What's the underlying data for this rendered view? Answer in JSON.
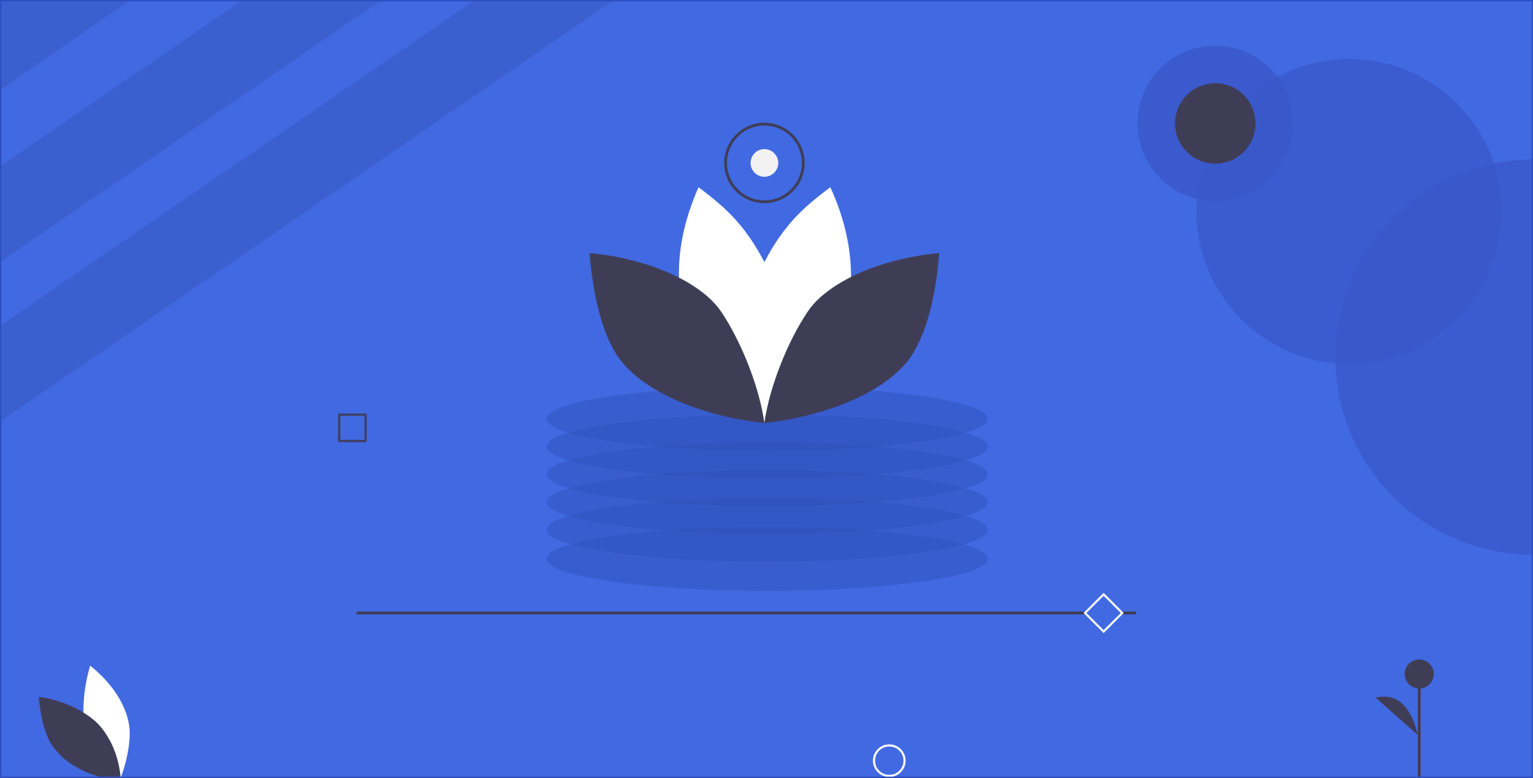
{
  "palette": {
    "background": "#4169e1",
    "frame": "#2e4fc2",
    "stripe": "#3b5fcf",
    "circle_shade": "#3958c9",
    "ripple": "#2f4fb9",
    "dark": "#3f3d56",
    "white": "#ffffff",
    "offwhite": "#f2f2f2"
  },
  "illustration": {
    "subject": "lotus-flower-with-water-ripples",
    "decorations": [
      "diagonal-stripes",
      "overlapping-circles",
      "hollow-square",
      "diamond-marker",
      "small-ring",
      "sprout",
      "seedling"
    ]
  }
}
